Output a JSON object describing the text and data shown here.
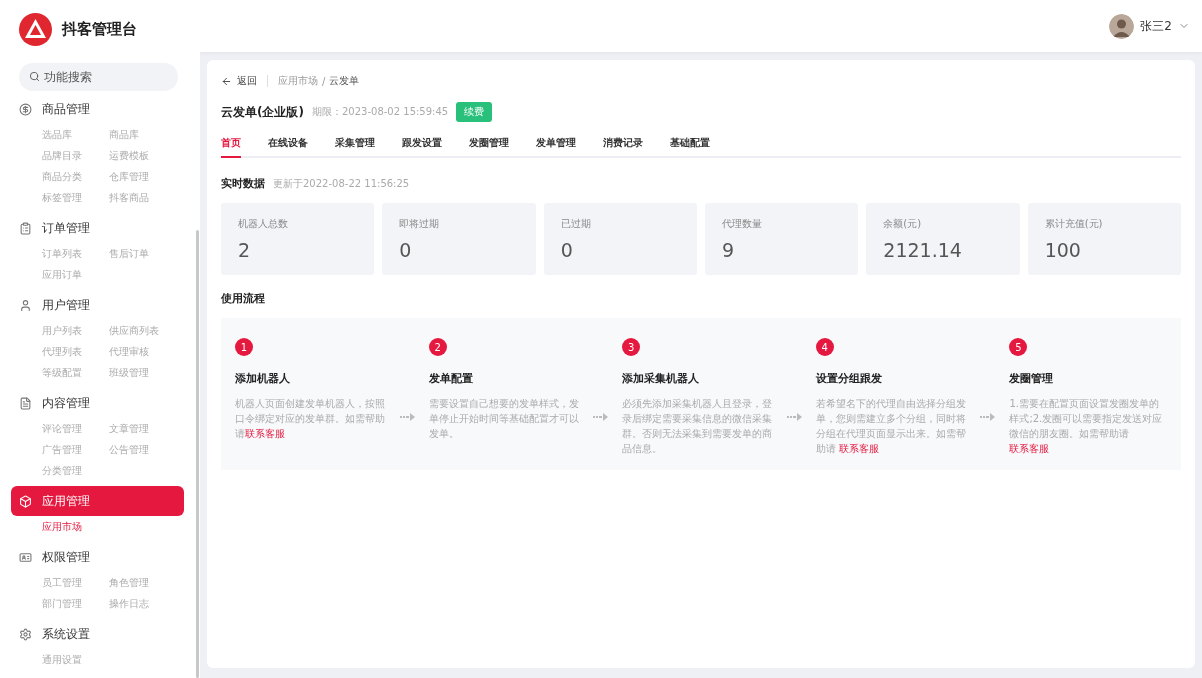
{
  "app": {
    "name": "抖客管理台"
  },
  "sidebar": {
    "search": {
      "placeholder": "功能搜索"
    },
    "groups": [
      {
        "label": "商品管理",
        "selected": false,
        "children": [
          {
            "label": "选品库",
            "selected": false
          },
          {
            "label": "商品库",
            "selected": false
          },
          {
            "label": "品牌目录",
            "selected": false
          },
          {
            "label": "运费模板",
            "selected": false
          },
          {
            "label": "商品分类",
            "selected": false
          },
          {
            "label": "仓库管理",
            "selected": false
          },
          {
            "label": "标签管理",
            "selected": false
          },
          {
            "label": "抖客商品",
            "selected": false
          }
        ]
      },
      {
        "label": "订单管理",
        "selected": false,
        "children": [
          {
            "label": "订单列表",
            "selected": false
          },
          {
            "label": "售后订单",
            "selected": false
          },
          {
            "label": "应用订单",
            "selected": false
          }
        ]
      },
      {
        "label": "用户管理",
        "selected": false,
        "children": [
          {
            "label": "用户列表",
            "selected": false
          },
          {
            "label": "供应商列表",
            "selected": false
          },
          {
            "label": "代理列表",
            "selected": false
          },
          {
            "label": "代理审核",
            "selected": false
          },
          {
            "label": "等级配置",
            "selected": false
          },
          {
            "label": "班级管理",
            "selected": false
          }
        ]
      },
      {
        "label": "内容管理",
        "selected": false,
        "children": [
          {
            "label": "评论管理",
            "selected": false
          },
          {
            "label": "文章管理",
            "selected": false
          },
          {
            "label": "广告管理",
            "selected": false
          },
          {
            "label": "公告管理",
            "selected": false
          },
          {
            "label": "分类管理",
            "selected": false
          }
        ]
      },
      {
        "label": "应用管理",
        "selected": true,
        "children": [
          {
            "label": "应用市场",
            "selected": true
          }
        ]
      },
      {
        "label": "权限管理",
        "selected": false,
        "children": [
          {
            "label": "员工管理",
            "selected": false
          },
          {
            "label": "角色管理",
            "selected": false
          },
          {
            "label": "部门管理",
            "selected": false
          },
          {
            "label": "操作日志",
            "selected": false
          }
        ]
      },
      {
        "label": "系统设置",
        "selected": false,
        "children": [
          {
            "label": "通用设置",
            "selected": false
          }
        ]
      }
    ]
  },
  "topbar": {
    "user": "张三2"
  },
  "page": {
    "back": "返回",
    "breadcrumb": [
      "应用市场",
      "云发单"
    ],
    "breadcrumb_separator": "/",
    "title": "云发单(企业版)",
    "expiry": "期限：2023-08-02 15:59:45",
    "renew": "续费",
    "tabs": [
      {
        "label": "首页",
        "selected": true
      },
      {
        "label": "在线设备",
        "selected": false
      },
      {
        "label": "采集管理",
        "selected": false
      },
      {
        "label": "跟发设置",
        "selected": false
      },
      {
        "label": "发圈管理",
        "selected": false
      },
      {
        "label": "发单管理",
        "selected": false
      },
      {
        "label": "消费记录",
        "selected": false
      },
      {
        "label": "基础配置",
        "selected": false
      }
    ],
    "realtime": {
      "title": "实时数据",
      "updated": "更新于2022-08-22 11:56:25",
      "stats": [
        {
          "label": "机器人总数",
          "value": "2"
        },
        {
          "label": "即将过期",
          "value": "0"
        },
        {
          "label": "已过期",
          "value": "0"
        },
        {
          "label": "代理数量",
          "value": "9"
        },
        {
          "label": "余额(元)",
          "value": "2121.14"
        },
        {
          "label": "累计充值(元)",
          "value": "100"
        }
      ]
    },
    "flow": {
      "title": "使用流程",
      "steps": [
        {
          "number": "1",
          "title": "添加机器人",
          "text": "机器人页面创建发单机器人，按照口令绑定对应的发单群。如需帮助请",
          "link": "联系客服"
        },
        {
          "number": "2",
          "title": "发单配置",
          "text": "需要设置自己想要的发单样式，发单停止开始时间等基础配置才可以发单。"
        },
        {
          "number": "3",
          "title": "添加采集机器人",
          "text": "必须先添加采集机器人且登录，登录后绑定需要采集信息的微信采集群。否则无法采集到需要发单的商品信息。"
        },
        {
          "number": "4",
          "title": "设置分组跟发",
          "text": "若希望名下的代理自由选择分组发单，您则需建立多个分组，同时将分组在代理页面显示出来。如需帮助请 ",
          "link": "联系客服"
        },
        {
          "number": "5",
          "title": "发圈管理",
          "text": "1.需要在配置页面设置发圈发单的样式;2.发圈可以需要指定发送对应微信的朋友圈。如需帮助请 ",
          "link": "联系客服"
        }
      ]
    }
  }
}
